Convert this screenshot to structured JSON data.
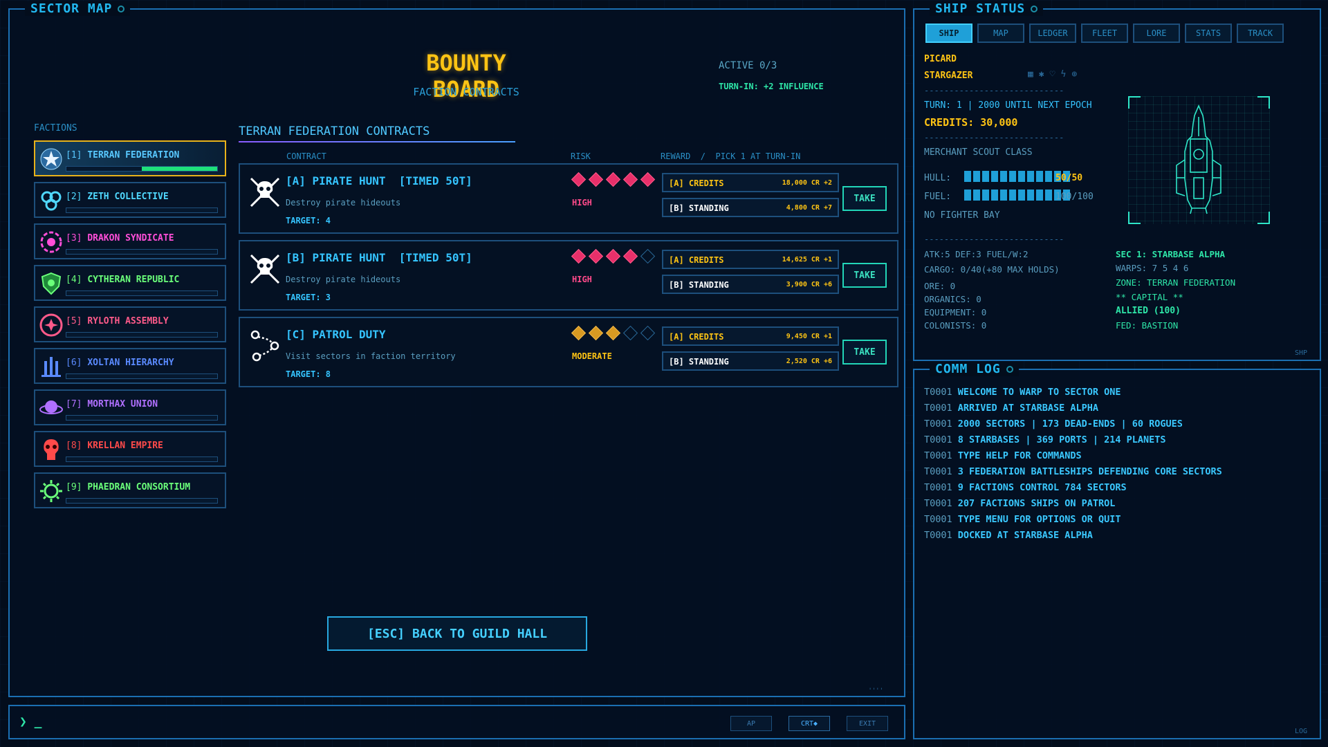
{
  "sector_map": {
    "title": "SECTOR MAP",
    "bounty_title": "BOUNTY BOARD",
    "bounty_subtitle": "FACTION CONTRACTS",
    "active": "ACTIVE 0/3",
    "turn_in": "TURN-IN: +2 INFLUENCE",
    "factions_label": "FACTIONS",
    "factions": [
      {
        "num": "[1]",
        "name": "TERRAN FEDERATION",
        "color": "#58c8ff",
        "icon": "star-emblem-icon",
        "standing": 0.5
      },
      {
        "num": "[2]",
        "name": "ZETH COLLECTIVE",
        "color": "#50d8ff",
        "icon": "swirl-cells-icon",
        "standing": 0
      },
      {
        "num": "[3]",
        "name": "DRAKON SYNDICATE",
        "color": "#ff4ed8",
        "icon": "dragon-ring-icon",
        "standing": 0
      },
      {
        "num": "[4]",
        "name": "CYTHERAN REPUBLIC",
        "color": "#6aff7a",
        "icon": "shield-flower-icon",
        "standing": 0
      },
      {
        "num": "[5]",
        "name": "RYLOTH ASSEMBLY",
        "color": "#ff5a8a",
        "icon": "circle-star-icon",
        "standing": 0
      },
      {
        "num": "[6]",
        "name": "XOLTAN HIERARCHY",
        "color": "#5a8aff",
        "icon": "spires-icon",
        "standing": 0
      },
      {
        "num": "[7]",
        "name": "MORTHAX UNION",
        "color": "#b070ff",
        "icon": "planet-ring-icon",
        "standing": 0
      },
      {
        "num": "[8]",
        "name": "KRELLAN EMPIRE",
        "color": "#ff4a4a",
        "icon": "skull-helm-icon",
        "standing": 0
      },
      {
        "num": "[9]",
        "name": "PHAEDRAN CONSORTIUM",
        "color": "#6aff7a",
        "icon": "sun-gear-icon",
        "standing": 0
      }
    ],
    "contracts_title": "TERRAN FEDERATION CONTRACTS",
    "col_contract": "CONTRACT",
    "col_risk": "RISK",
    "col_reward": "REWARD  /  PICK 1 AT TURN-IN",
    "contracts": [
      {
        "title": "[A] PIRATE HUNT  [TIMED 50T]",
        "desc": "Destroy pirate hideouts",
        "target": "TARGET: 4",
        "risk_level": 5,
        "risk": "HIGH",
        "reward_a_label": "[A] CREDITS",
        "reward_a_value": "18,000 CR +2",
        "reward_b_label": "[B] STANDING",
        "reward_b_value": "4,800 CR +7",
        "take": "TAKE"
      },
      {
        "title": "[B] PIRATE HUNT  [TIMED 50T]",
        "desc": "Destroy pirate hideouts",
        "target": "TARGET: 3",
        "risk_level": 4,
        "risk": "HIGH",
        "reward_a_label": "[A] CREDITS",
        "reward_a_value": "14,625 CR +1",
        "reward_b_label": "[B] STANDING",
        "reward_b_value": "3,900 CR +6",
        "take": "TAKE"
      },
      {
        "title": "[C] PATROL DUTY",
        "desc": "Visit sectors in faction territory",
        "target": "TARGET: 8",
        "risk_level": 3,
        "risk": "MODERATE",
        "reward_a_label": "[A] CREDITS",
        "reward_a_value": "9,450 CR +1",
        "reward_b_label": "[B] STANDING",
        "reward_b_value": "2,520 CR +6",
        "take": "TAKE"
      }
    ],
    "back_button": "[ESC] BACK TO GUILD HALL",
    "corner_mark": "''''"
  },
  "cmd_bar": {
    "prompt": "❯ _",
    "buttons": [
      "AP",
      "CRT◆",
      "EXIT"
    ]
  },
  "ship_status": {
    "title": "SHIP STATUS",
    "tabs": [
      "SHIP",
      "MAP",
      "LEDGER",
      "FLEET",
      "LORE",
      "STATS",
      "TRACK"
    ],
    "captain": "PICARD",
    "ship_name": "STARGAZER",
    "separator": "----------------------------",
    "turn": "TURN: 1 | 2000 UNTIL NEXT EPOCH",
    "credits": "CREDITS: 30,000",
    "class": "MERCHANT SCOUT CLASS",
    "hull_label": "HULL:",
    "hull_value": "50/50",
    "hull_fraction": 1,
    "fuel_label": "FUEL:",
    "fuel_value": "100/100",
    "fuel_fraction": 1,
    "fighter_bay": "NO FIGHTER BAY",
    "atk_def": "ATK:5 DEF:3 FUEL/W:2",
    "cargo": "CARGO: 0/40(+80 MAX HOLDS)",
    "ore": "ORE: 0",
    "organics": "ORGANICS: 0",
    "equipment": "EQUIPMENT: 0",
    "colonists": "COLONISTS: 0",
    "sector": "SEC 1: STARBASE ALPHA",
    "warps": "WARPS: 7 5 4 6",
    "zone": "ZONE: TERRAN FEDERATION",
    "capital": "** CAPITAL **",
    "allied": "ALLIED (100)",
    "fed": "FED: BASTION",
    "corner_label": "SHP"
  },
  "comm_log": {
    "title": "COMM LOG",
    "corner_label": "LOG",
    "lines": [
      {
        "t": "T0001",
        "m": "WELCOME TO WARP TO SECTOR ONE"
      },
      {
        "t": "T0001",
        "m": "ARRIVED AT STARBASE ALPHA"
      },
      {
        "t": "T0001",
        "m": "2000 SECTORS | 173 DEAD-ENDS | 60 ROGUES"
      },
      {
        "t": "T0001",
        "m": "8 STARBASES | 369 PORTS | 214 PLANETS"
      },
      {
        "t": "T0001",
        "m": "TYPE HELP FOR COMMANDS"
      },
      {
        "t": "T0001",
        "m": "3 FEDERATION BATTLESHIPS DEFENDING CORE SECTORS"
      },
      {
        "t": "T0001",
        "m": "9 FACTIONS CONTROL 784 SECTORS"
      },
      {
        "t": "T0001",
        "m": "207 FACTIONS SHIPS ON PATROL"
      },
      {
        "t": "T0001",
        "m": "TYPE MENU FOR OPTIONS OR QUIT"
      },
      {
        "t": "T0001",
        "m": "DOCKED AT STARBASE ALPHA"
      }
    ]
  }
}
